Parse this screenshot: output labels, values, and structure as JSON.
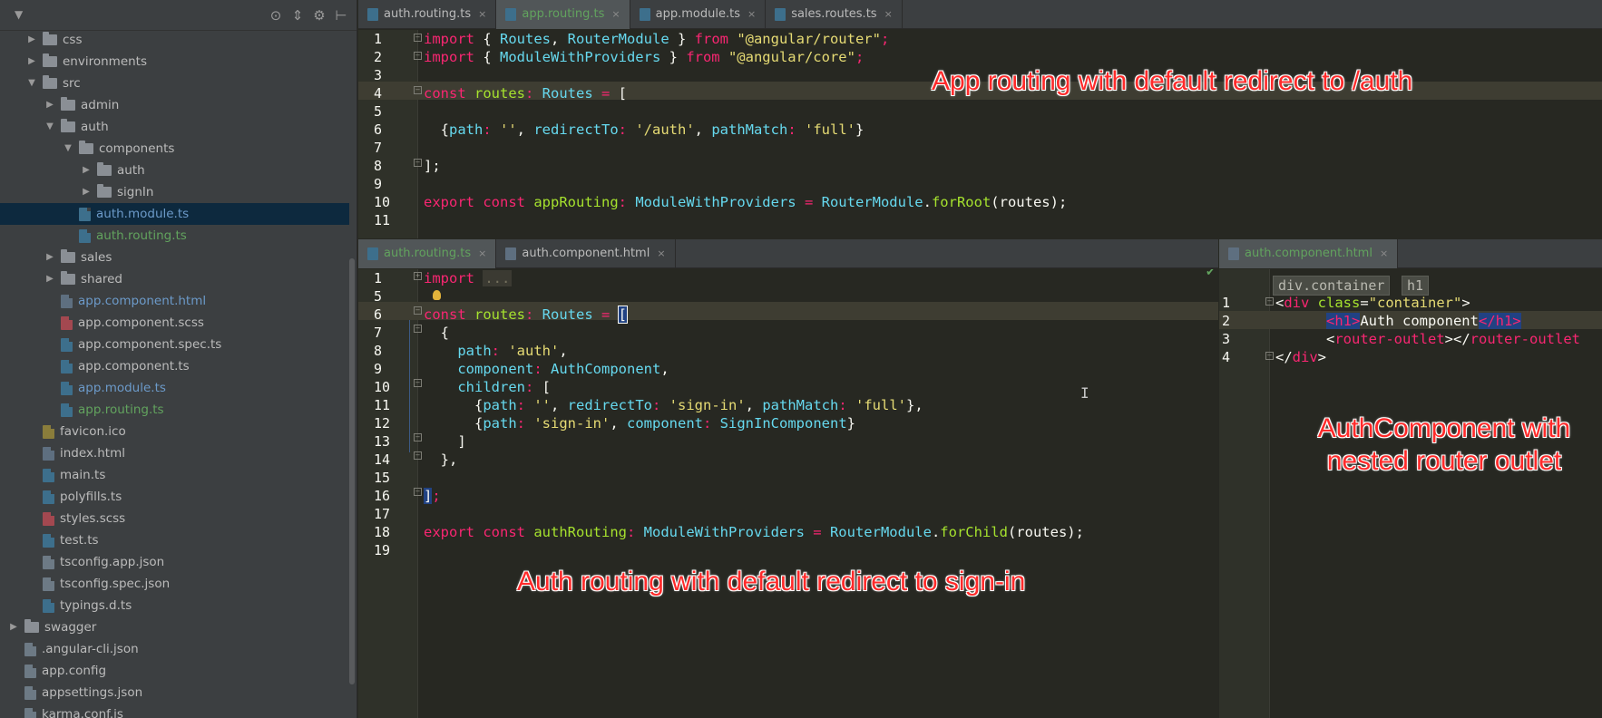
{
  "tree": {
    "tool_icons": [
      "target-icon",
      "expand-icon",
      "gear-icon",
      "pin-icon"
    ],
    "items": [
      {
        "label": "css",
        "type": "folder",
        "depth": 1,
        "expanded": false
      },
      {
        "label": "environments",
        "type": "folder",
        "depth": 1,
        "expanded": false
      },
      {
        "label": "src",
        "type": "folder",
        "depth": 1,
        "expanded": true
      },
      {
        "label": "admin",
        "type": "folder",
        "depth": 2,
        "expanded": false
      },
      {
        "label": "auth",
        "type": "folder",
        "depth": 2,
        "expanded": true
      },
      {
        "label": "components",
        "type": "folder",
        "depth": 3,
        "expanded": true
      },
      {
        "label": "auth",
        "type": "folder",
        "depth": 4,
        "expanded": false
      },
      {
        "label": "signIn",
        "type": "folder",
        "depth": 4,
        "expanded": false
      },
      {
        "label": "auth.module.ts",
        "type": "ts",
        "depth": 3,
        "color": "blue",
        "selected": true
      },
      {
        "label": "auth.routing.ts",
        "type": "ts",
        "depth": 3,
        "color": "green"
      },
      {
        "label": "sales",
        "type": "folder",
        "depth": 2,
        "expanded": false
      },
      {
        "label": "shared",
        "type": "folder",
        "depth": 2,
        "expanded": false
      },
      {
        "label": "app.component.html",
        "type": "html",
        "depth": 2,
        "color": "blue"
      },
      {
        "label": "app.component.scss",
        "type": "scss",
        "depth": 2,
        "color": "default"
      },
      {
        "label": "app.component.spec.ts",
        "type": "ts",
        "depth": 2,
        "color": "default"
      },
      {
        "label": "app.component.ts",
        "type": "ts",
        "depth": 2,
        "color": "default"
      },
      {
        "label": "app.module.ts",
        "type": "ts",
        "depth": 2,
        "color": "blue"
      },
      {
        "label": "app.routing.ts",
        "type": "ts",
        "depth": 2,
        "color": "green"
      },
      {
        "label": "favicon.ico",
        "type": "ico",
        "depth": 1,
        "color": "default"
      },
      {
        "label": "index.html",
        "type": "html",
        "depth": 1,
        "color": "default"
      },
      {
        "label": "main.ts",
        "type": "ts",
        "depth": 1,
        "color": "default"
      },
      {
        "label": "polyfills.ts",
        "type": "ts",
        "depth": 1,
        "color": "default"
      },
      {
        "label": "styles.scss",
        "type": "scss",
        "depth": 1,
        "color": "default"
      },
      {
        "label": "test.ts",
        "type": "ts",
        "depth": 1,
        "color": "default"
      },
      {
        "label": "tsconfig.app.json",
        "type": "json",
        "depth": 1,
        "color": "default"
      },
      {
        "label": "tsconfig.spec.json",
        "type": "json",
        "depth": 1,
        "color": "default"
      },
      {
        "label": "typings.d.ts",
        "type": "ts",
        "depth": 1,
        "color": "default"
      },
      {
        "label": "swagger",
        "type": "folder",
        "depth": 0,
        "expanded": false
      },
      {
        "label": ".angular-cli.json",
        "type": "json",
        "depth": 0,
        "color": "default"
      },
      {
        "label": "app.config",
        "type": "json",
        "depth": 0,
        "color": "default"
      },
      {
        "label": "appsettings.json",
        "type": "json",
        "depth": 0,
        "color": "default"
      },
      {
        "label": "karma.conf.js",
        "type": "json",
        "depth": 0,
        "color": "default"
      }
    ]
  },
  "top_tabs": [
    {
      "label": "auth.routing.ts",
      "active": false
    },
    {
      "label": "app.routing.ts",
      "active": true
    },
    {
      "label": "app.module.ts",
      "active": false
    },
    {
      "label": "sales.routes.ts",
      "active": false
    }
  ],
  "bottom_left_tabs": [
    {
      "label": "auth.routing.ts",
      "active": true
    },
    {
      "label": "auth.component.html",
      "active": false
    }
  ],
  "bottom_right_tabs": [
    {
      "label": "auth.component.html",
      "active": true
    }
  ],
  "close_glyph": "×",
  "top_editor": {
    "line_numbers": [
      "1",
      "2",
      "3",
      "4",
      "5",
      "6",
      "7",
      "8",
      "9",
      "10",
      "11"
    ],
    "code": {
      "l1_kw": "import",
      "l1_a": " { ",
      "l1_t1": "Routes",
      "l1_b": ", ",
      "l1_t2": "RouterModule",
      "l1_c": " } ",
      "l1_from": "from",
      "l1_s": " \"@angular/router\"",
      "l1_semi": ";",
      "l2_kw": "import",
      "l2_a": " { ",
      "l2_t1": "ModuleWithProviders",
      "l2_c": " } ",
      "l2_from": "from",
      "l2_s": " \"@angular/core\"",
      "l2_semi": ";",
      "l4_kw": "const",
      "l4_id": " routes",
      "l4_colon": ":",
      "l4_ty": " Routes",
      "l4_eq": " = ",
      "l4_br": "[",
      "l6_open": "  {",
      "l6_k1": "path",
      "l6_c1": ": ",
      "l6_v1": "''",
      "l6_s1": ", ",
      "l6_k2": "redirectTo",
      "l6_c2": ": ",
      "l6_v2": "'/auth'",
      "l6_s2": ", ",
      "l6_k3": "pathMatch",
      "l6_c3": ": ",
      "l6_v3": "'full'",
      "l6_close": "}",
      "l8": "];",
      "l10_kw1": "export",
      "l10_kw2": " const",
      "l10_id": " appRouting",
      "l10_colon": ":",
      "l10_ty": " ModuleWithProviders",
      "l10_eq": " = ",
      "l10_obj": "RouterModule",
      "l10_dot": ".",
      "l10_fn": "forRoot",
      "l10_arg": "(routes);"
    }
  },
  "bottom_left_editor": {
    "line_numbers": [
      "1",
      "5",
      "6",
      "7",
      "8",
      "9",
      "10",
      "11",
      "12",
      "13",
      "14",
      "15",
      "16",
      "17",
      "18",
      "19"
    ],
    "code": {
      "l1_kw": "import",
      "l1_fold": "...",
      "l6_kw": "const",
      "l6_id": " routes",
      "l6_colon": ":",
      "l6_ty": " Routes",
      "l6_eq": " = ",
      "l6_br": "[",
      "l7": "  {",
      "l8_k": "    path",
      "l8_c": ": ",
      "l8_v": "'auth'",
      "l8_e": ",",
      "l9_k": "    component",
      "l9_c": ": ",
      "l9_v": "AuthComponent",
      "l9_e": ",",
      "l10_k": "    children",
      "l10_c": ": ",
      "l10_v": "[",
      "l11_o": "      {",
      "l11_k1": "path",
      "l11_c1": ": ",
      "l11_v1": "''",
      "l11_s1": ", ",
      "l11_k2": "redirectTo",
      "l11_c2": ": ",
      "l11_v2": "'sign-in'",
      "l11_s2": ", ",
      "l11_k3": "pathMatch",
      "l11_c3": ": ",
      "l11_v3": "'full'",
      "l11_e": "},",
      "l12_o": "      {",
      "l12_k1": "path",
      "l12_c1": ": ",
      "l12_v1": "'sign-in'",
      "l12_s1": ", ",
      "l12_k2": "component",
      "l12_c2": ": ",
      "l12_v2": "SignInComponent",
      "l12_e": "}",
      "l13": "    ]",
      "l14": "  },",
      "l16_br": "]",
      "l16_semi": ";",
      "l18_kw1": "export",
      "l18_kw2": " const",
      "l18_id": " authRouting",
      "l18_colon": ":",
      "l18_ty": " ModuleWithProviders",
      "l18_eq": " = ",
      "l18_obj": "RouterModule",
      "l18_dot": ".",
      "l18_fn": "forChild",
      "l18_arg": "(routes);"
    }
  },
  "bottom_right_editor": {
    "breadcrumbs": [
      "div.container",
      "h1"
    ],
    "line_numbers": [
      "1",
      "2",
      "3",
      "4"
    ],
    "code": {
      "l1_lt": "<",
      "l1_tag": "div",
      "l1_attr": " class",
      "l1_eq": "=",
      "l1_val": "\"container\"",
      "l1_gt": ">",
      "l2_pad": "      ",
      "l2_o": "<h1>",
      "l2_text": "Auth component",
      "l2_c": "</h1>",
      "l3_pad": "      ",
      "l3_lt": "<",
      "l3_tag": "router-outlet",
      "l3_mid": "></",
      "l3_tag2": "router-outlet",
      "l4_lt": "</",
      "l4_tag": "div",
      "l4_gt": ">"
    }
  },
  "annotations": {
    "top": "App routing with default redirect to /auth",
    "bottom": "Auth routing with default redirect to sign-in",
    "right": "AuthComponent with nested router outlet"
  }
}
